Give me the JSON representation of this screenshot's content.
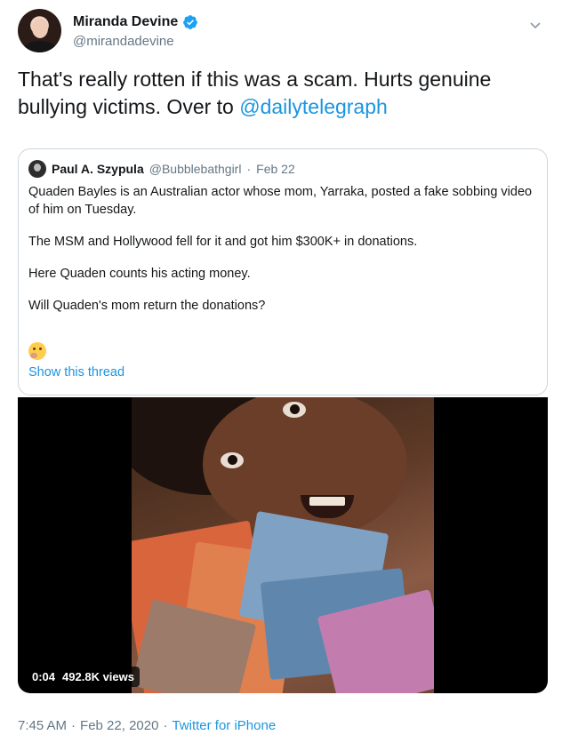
{
  "author": {
    "display_name": "Miranda Devine",
    "handle": "@mirandadevine"
  },
  "tweet": {
    "text": "That's really rotten if this was a scam. Hurts genuine bullying victims. Over to ",
    "mention": "@dailytelegraph"
  },
  "quoted_tweet": {
    "display_name": "Paul A. Szypula",
    "handle": "@Bubblebathgirl",
    "separator": "·",
    "date": "Feb 22",
    "paragraphs": [
      "Quaden Bayles is an Australian actor whose mom, Yarraka, posted a fake sobbing video of him on Tuesday.",
      "The MSM and Hollywood fell for it and got him $300K+ in donations.",
      "Here Quaden counts his acting money.",
      "Will Quaden's mom return the donations?"
    ],
    "emoji": "thinking-face",
    "show_thread": "Show this thread"
  },
  "video": {
    "duration": "0:04",
    "views": "492.8K views"
  },
  "meta": {
    "time": "7:45 AM",
    "separator1": "·",
    "date": "Feb 22, 2020",
    "separator2": "·",
    "source": "Twitter for iPhone"
  },
  "colors": {
    "link": "#1b95e0",
    "secondary_text": "#657786",
    "border": "#ccd6dd",
    "verified": "#1da1f2"
  },
  "icons": [
    "verified-badge-icon",
    "chevron-down-icon",
    "thinking-face-emoji"
  ]
}
